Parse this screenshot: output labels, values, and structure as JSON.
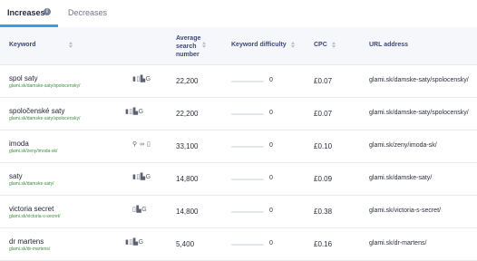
{
  "tabs": {
    "increases": "Increases",
    "info_icon": "i",
    "decreases": "Decreases"
  },
  "columns": {
    "keyword": "Keyword",
    "search_volume_line1": "Average",
    "search_volume_line2": "search",
    "search_volume_line3": "number",
    "difficulty": "Keyword difficulty",
    "cpc": "CPC",
    "url": "URL address"
  },
  "rows": [
    {
      "keyword": "spol saty",
      "kw_url": "glami.sk/damske-saty/spolocensky/",
      "serp": "▮▯▙G",
      "volume": "22,200",
      "difficulty": "0",
      "cpc": "£0.07",
      "url": "glami.sk/damske-saty/spolocensky/"
    },
    {
      "keyword": "spoločenské saty",
      "kw_url": "glami.sk/damske-saty/spolocensky/",
      "serp": "▮▯▙G",
      "volume": "22,200",
      "difficulty": "0",
      "cpc": "£0.07",
      "url": "glami.sk/damske-saty/spolocensky/"
    },
    {
      "keyword": "imoda",
      "kw_url": "glami.sk/zeny/imoda-sk/",
      "serp": "⚲ ∞ ▯",
      "volume": "33,100",
      "difficulty": "0",
      "cpc": "£0.10",
      "url": "glami.sk/zeny/imoda-sk/"
    },
    {
      "keyword": "saty",
      "kw_url": "glami.sk/damske-saty/",
      "serp": "▮▯▙G",
      "volume": "14,800",
      "difficulty": "0",
      "cpc": "£0.09",
      "url": "glami.sk/damske-saty/"
    },
    {
      "keyword": "victoria secret",
      "kw_url": "glami.sk/victoria-s-secret/",
      "serp": "▯▙G",
      "volume": "14,800",
      "difficulty": "0",
      "cpc": "£0.38",
      "url": "glami.sk/victoria-s-secret/"
    },
    {
      "keyword": "dr martens",
      "kw_url": "glami.sk/dr-martens/",
      "serp": "▮▯▙G",
      "volume": "5,400",
      "difficulty": "0",
      "cpc": "£0.16",
      "url": "glami.sk/dr-martens/"
    }
  ]
}
